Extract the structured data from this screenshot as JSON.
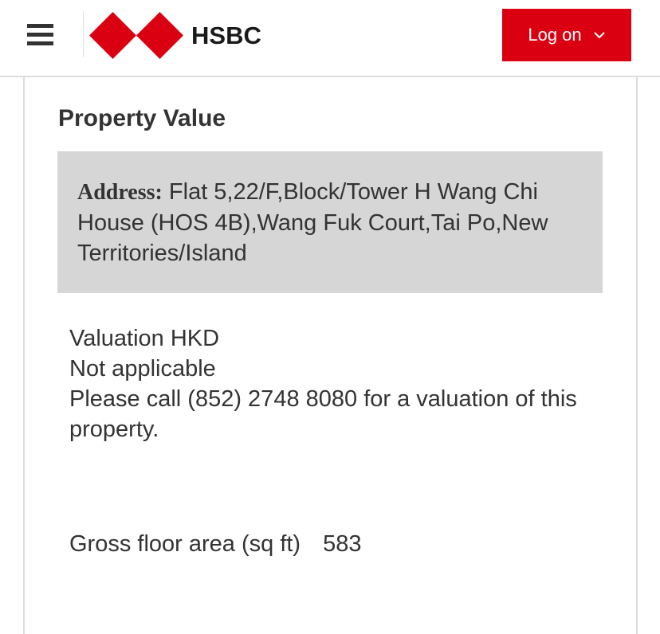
{
  "header": {
    "brand": "HSBC",
    "logon_label": "Log on",
    "menu_icon": "hamburger-menu-icon",
    "brand_color": "#db0011"
  },
  "property": {
    "title": "Property Value",
    "address_label": "Address:",
    "address_value": "Flat 5,22/F,Block/Tower H Wang Chi House (HOS 4B),Wang Fuk Court,Tai Po,New Territories/Island",
    "valuation_label": "Valuation HKD",
    "valuation_value": "Not applicable",
    "valuation_note": "Please call (852) 2748 8080 for a valuation of this property.",
    "gfa_label": "Gross floor area (sq ft)",
    "gfa_value": "583"
  }
}
